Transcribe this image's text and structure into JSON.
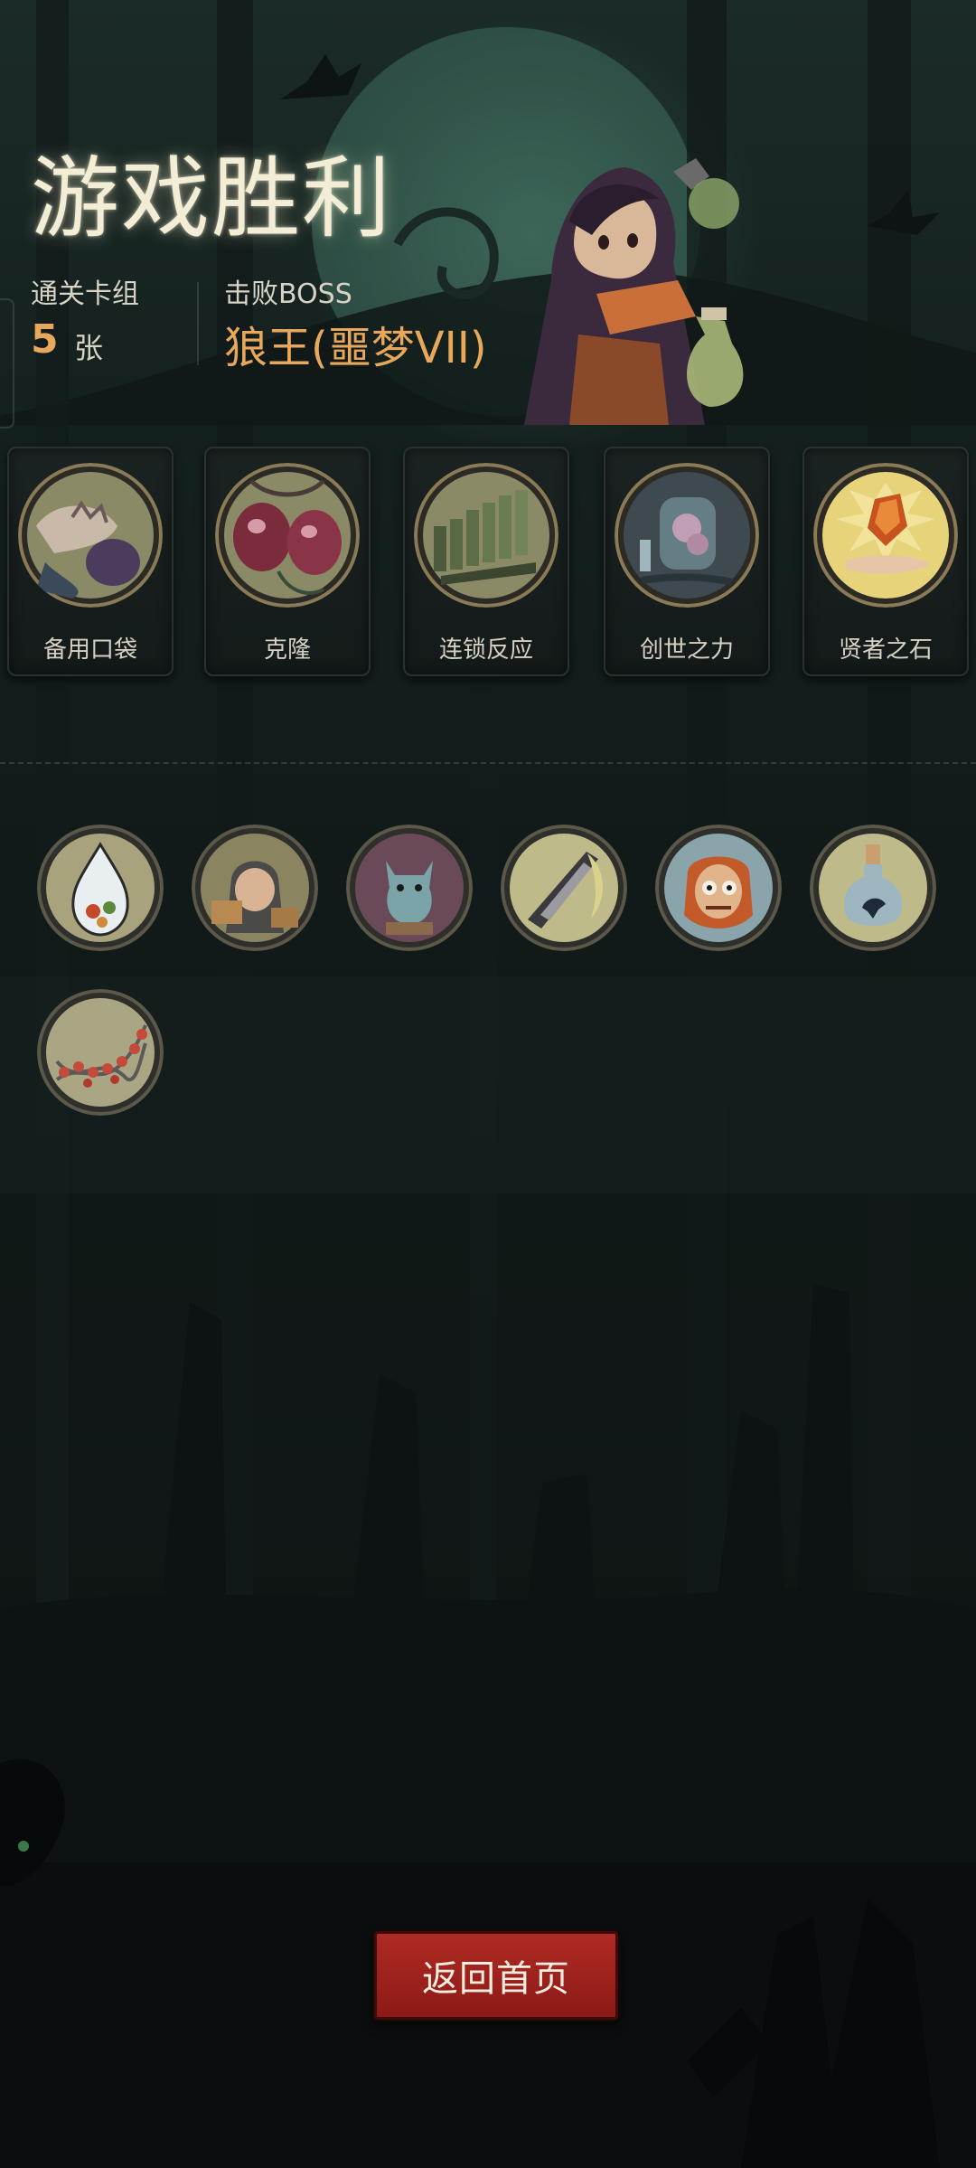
{
  "result": {
    "title": "游戏胜利",
    "deck_label": "通关卡组",
    "deck_count": "5",
    "deck_unit": "张",
    "boss_label": "击败BOSS",
    "boss_name": "狼王(噩梦VII)"
  },
  "relics": [
    {
      "name": "备用口袋",
      "icon": "spare-pocket-icon"
    },
    {
      "name": "克隆",
      "icon": "clone-icon"
    },
    {
      "name": "连锁反应",
      "icon": "chain-reaction-icon"
    },
    {
      "name": "创世之力",
      "icon": "genesis-power-icon"
    },
    {
      "name": "贤者之石",
      "icon": "philosophers-stone-icon"
    }
  ],
  "cards": [
    {
      "icon": "potion-drop-icon"
    },
    {
      "icon": "hooded-merchant-icon"
    },
    {
      "icon": "gargoyle-icon"
    },
    {
      "icon": "blade-icon"
    },
    {
      "icon": "crazed-man-icon"
    },
    {
      "icon": "bottled-crow-icon"
    },
    {
      "icon": "dna-helix-icon"
    }
  ],
  "actions": {
    "return_home": "返回首页"
  },
  "colors": {
    "accent_orange": "#e8a85b",
    "button_red": "#a3241f",
    "title_glow": "#f3edd6"
  }
}
